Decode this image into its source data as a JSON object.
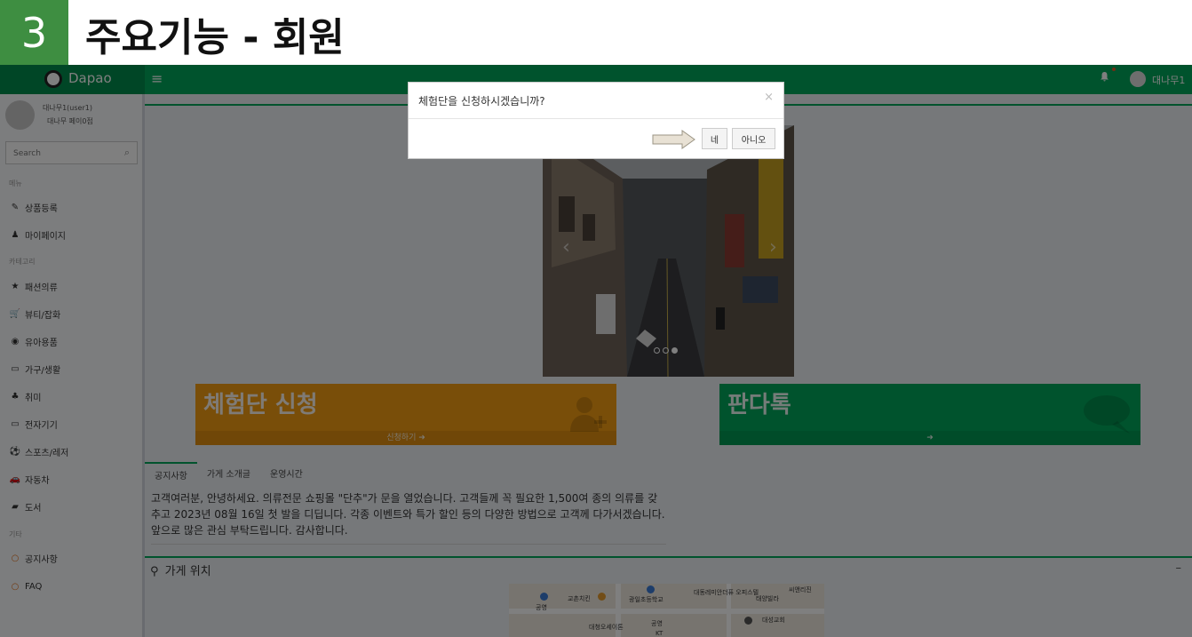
{
  "slide": {
    "number": "3",
    "title": "주요기능 - 회원"
  },
  "topnav": {
    "brand": "Dapao",
    "menu_glyph": "≡",
    "bell_glyph": "🔔",
    "user_label": "대나무1"
  },
  "sidebar": {
    "user_line1": "대나무1(user1)",
    "user_line2": "대나무 페이0점",
    "search_placeholder": "Search",
    "section_menu": "메뉴",
    "section_category": "카테고리",
    "section_etc": "기타",
    "menu_items": [
      {
        "icon": "edit-icon",
        "glyph": "✎",
        "label": "상품등록"
      },
      {
        "icon": "user-icon",
        "glyph": "♟",
        "label": "마이페이지"
      }
    ],
    "category_items": [
      {
        "icon": "star-icon",
        "glyph": "★",
        "label": "패션의류"
      },
      {
        "icon": "cart-icon",
        "glyph": "🛒",
        "label": "뷰티/잡화"
      },
      {
        "icon": "baby-icon",
        "glyph": "◉",
        "label": "유아용품"
      },
      {
        "icon": "laptop-icon",
        "glyph": "▭",
        "label": "가구/생활"
      },
      {
        "icon": "users-icon",
        "glyph": "♣",
        "label": "취미"
      },
      {
        "icon": "laptop-icon",
        "glyph": "▭",
        "label": "전자기기"
      },
      {
        "icon": "soccer-ball-icon",
        "glyph": "⚽",
        "label": "스포츠/레저"
      },
      {
        "icon": "car-icon",
        "glyph": "🚗",
        "label": "자동차"
      },
      {
        "icon": "book-icon",
        "glyph": "▰",
        "label": "도서"
      }
    ],
    "etc_items": [
      {
        "icon": "circle-icon",
        "glyph": "○",
        "label": "공지사항"
      },
      {
        "icon": "circle-icon",
        "glyph": "○",
        "label": "FAQ"
      }
    ]
  },
  "main": {
    "card_apply": {
      "title": "체험단 신청",
      "footer": "신청하기 ➜"
    },
    "card_talk": {
      "title": "판다톡",
      "footer": "➜"
    },
    "tabs": [
      "공지사항",
      "가게 소개글",
      "운영시간"
    ],
    "notice": "고객여러분, 안녕하세요. 의류전문 쇼핑몰 \"단추\"가 문을 열었습니다. 고객들께 꼭 필요한 1,500여 종의 의류를 갖추고 2023년 08월 16일 첫 발을 디딥니다. 각종 이벤트와 특가 할인 등의 다양한 방법으로 고객께 다가서겠습니다. 앞으로 많은 관심 부탁드립니다. 감사합니다.",
    "location_title": "가게 위치",
    "location_min": "–",
    "map_labels": [
      "교촌치킨",
      "광일초등학교",
      "대동레미안더퓨 오피스텔",
      "태양빌라",
      "씨앤리진",
      "대성교회",
      "대청오세이톤",
      "공영",
      "KT",
      "공영"
    ]
  },
  "modal": {
    "title": "체험단을 신청하시겠습니까?",
    "close": "×",
    "yes": "네",
    "no": "아니오"
  },
  "colors": {
    "green": "#00a65a",
    "green_dark": "#008d4c",
    "orange": "#f39c12",
    "slide_green": "#3e8e41"
  }
}
